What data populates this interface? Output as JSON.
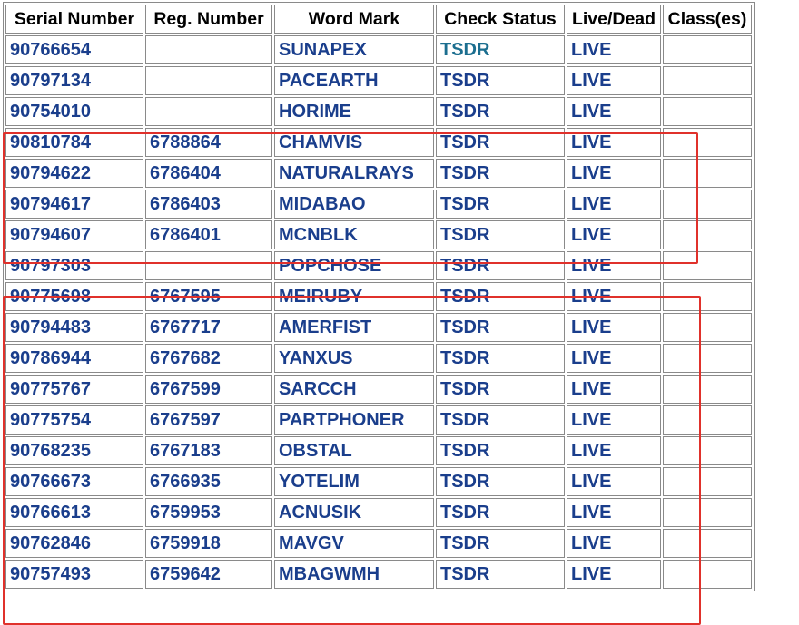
{
  "table": {
    "headers": {
      "serial": "Serial Number",
      "reg": "Reg. Number",
      "mark": "Word Mark",
      "status": "Check Status",
      "live": "Live/Dead",
      "classes": "Class(es)"
    },
    "rows": [
      {
        "serial": "90766654",
        "reg": "",
        "mark": "SUNAPEX",
        "status": "TSDR",
        "live": "LIVE",
        "classes": "",
        "status_visited": true
      },
      {
        "serial": "90797134",
        "reg": "",
        "mark": "PACEARTH",
        "status": "TSDR",
        "live": "LIVE",
        "classes": ""
      },
      {
        "serial": "90754010",
        "reg": "",
        "mark": "HORIME",
        "status": "TSDR",
        "live": "LIVE",
        "classes": ""
      },
      {
        "serial": "90810784",
        "reg": "6788864",
        "mark": "CHAMVIS",
        "status": "TSDR",
        "live": "LIVE",
        "classes": ""
      },
      {
        "serial": "90794622",
        "reg": "6786404",
        "mark": "NATURALRAYS",
        "status": "TSDR",
        "live": "LIVE",
        "classes": ""
      },
      {
        "serial": "90794617",
        "reg": "6786403",
        "mark": "MIDABAO",
        "status": "TSDR",
        "live": "LIVE",
        "classes": ""
      },
      {
        "serial": "90794607",
        "reg": "6786401",
        "mark": "MCNBLK",
        "status": "TSDR",
        "live": "LIVE",
        "classes": ""
      },
      {
        "serial": "90797303",
        "reg": "",
        "mark": "POPCHOSE",
        "status": "TSDR",
        "live": "LIVE",
        "classes": ""
      },
      {
        "serial": "90775698",
        "reg": "6767595",
        "mark": "MEIRUBY",
        "status": "TSDR",
        "live": "LIVE",
        "classes": ""
      },
      {
        "serial": "90794483",
        "reg": "6767717",
        "mark": "AMERFIST",
        "status": "TSDR",
        "live": "LIVE",
        "classes": ""
      },
      {
        "serial": "90786944",
        "reg": "6767682",
        "mark": "YANXUS",
        "status": "TSDR",
        "live": "LIVE",
        "classes": ""
      },
      {
        "serial": "90775767",
        "reg": "6767599",
        "mark": "SARCCH",
        "status": "TSDR",
        "live": "LIVE",
        "classes": ""
      },
      {
        "serial": "90775754",
        "reg": "6767597",
        "mark": "PARTPHONER",
        "status": "TSDR",
        "live": "LIVE",
        "classes": ""
      },
      {
        "serial": "90768235",
        "reg": "6767183",
        "mark": "OBSTAL",
        "status": "TSDR",
        "live": "LIVE",
        "classes": ""
      },
      {
        "serial": "90766673",
        "reg": "6766935",
        "mark": "YOTELIM",
        "status": "TSDR",
        "live": "LIVE",
        "classes": ""
      },
      {
        "serial": "90766613",
        "reg": "6759953",
        "mark": "ACNUSIK",
        "status": "TSDR",
        "live": "LIVE",
        "classes": ""
      },
      {
        "serial": "90762846",
        "reg": "6759918",
        "mark": "MAVGV",
        "status": "TSDR",
        "live": "LIVE",
        "classes": ""
      },
      {
        "serial": "90757493",
        "reg": "6759642",
        "mark": "MBAGWMH",
        "status": "TSDR",
        "live": "LIVE",
        "classes": ""
      }
    ]
  },
  "colors": {
    "link": "#1a3e8c",
    "visited_link": "#1b6e8f",
    "highlight_border": "#e0312b",
    "cell_border": "#8a8a8a"
  }
}
